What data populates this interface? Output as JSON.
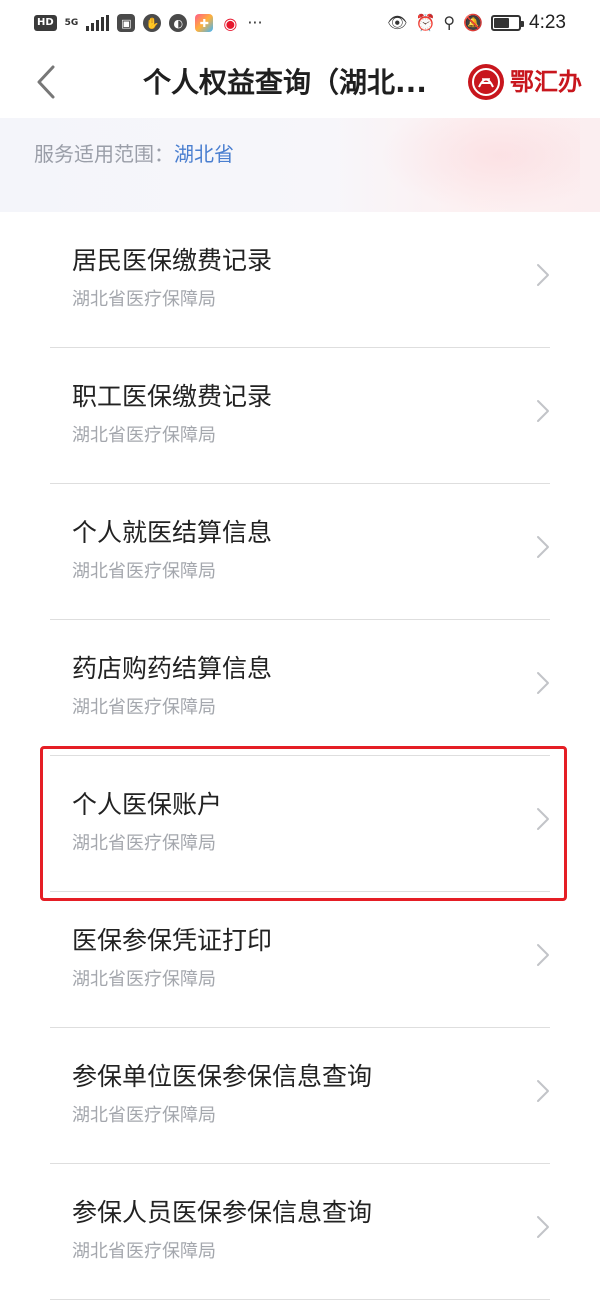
{
  "status_bar": {
    "hd_badge": "HD",
    "network": "5G",
    "time": "4:23",
    "battery_level": 0.62
  },
  "nav": {
    "title": "个人权益查询（湖北...",
    "brand_name": "鄂汇办",
    "accent_color": "#c8161d"
  },
  "scope": {
    "label": "服务适用范围：",
    "value": "湖北省"
  },
  "services": [
    {
      "title": "居民医保缴费记录",
      "provider": "湖北省医疗保障局"
    },
    {
      "title": "职工医保缴费记录",
      "provider": "湖北省医疗保障局"
    },
    {
      "title": "个人就医结算信息",
      "provider": "湖北省医疗保障局"
    },
    {
      "title": "药店购药结算信息",
      "provider": "湖北省医疗保障局"
    },
    {
      "title": "个人医保账户",
      "provider": "湖北省医疗保障局"
    },
    {
      "title": "医保参保凭证打印",
      "provider": "湖北省医疗保障局"
    },
    {
      "title": "参保单位医保参保信息查询",
      "provider": "湖北省医疗保障局"
    },
    {
      "title": "参保人员医保参保信息查询",
      "provider": "湖北省医疗保障局"
    }
  ],
  "highlight_color": "#e51e25"
}
